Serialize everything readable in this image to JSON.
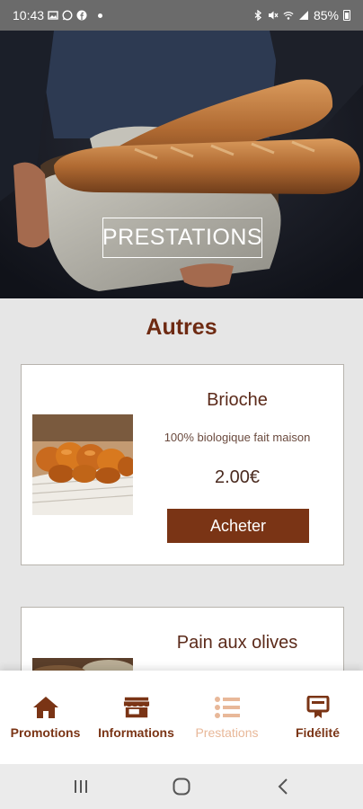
{
  "status_bar": {
    "time": "10:43",
    "battery": "85%"
  },
  "hero": {
    "title": "PRESTATIONS"
  },
  "section": {
    "title": "Autres"
  },
  "products": [
    {
      "name": "Brioche",
      "description": "100% biologique fait maison",
      "price": "2.00€",
      "button_label": "Acheter"
    },
    {
      "name": "Pain aux olives"
    }
  ],
  "bottom_nav": {
    "items": [
      {
        "label": "Promotions",
        "icon": "home-icon",
        "active": false
      },
      {
        "label": "Informations",
        "icon": "store-icon",
        "active": false
      },
      {
        "label": "Prestations",
        "icon": "list-icon",
        "active": true
      },
      {
        "label": "Fidélité",
        "icon": "loyalty-card-icon",
        "active": false
      }
    ]
  },
  "colors": {
    "accent": "#7a3415",
    "title": "#6e2a12",
    "active_nav": "#e8b899",
    "background": "#e6e6e6"
  }
}
